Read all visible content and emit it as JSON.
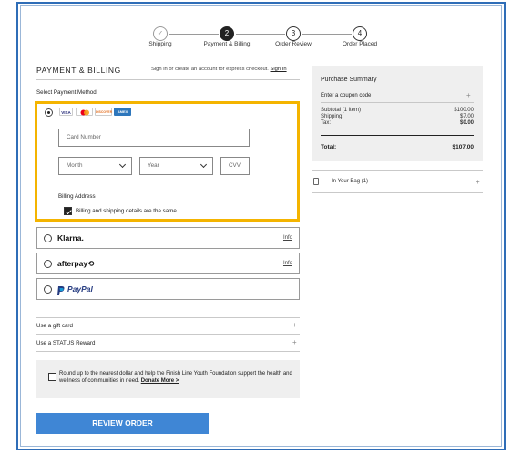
{
  "stepper": {
    "steps": [
      {
        "number": "✓",
        "label": "Shipping"
      },
      {
        "number": "2",
        "label": "Payment & Billing"
      },
      {
        "number": "3",
        "label": "Order Review"
      },
      {
        "number": "4",
        "label": "Order Placed"
      }
    ]
  },
  "header": {
    "title": "PAYMENT & BILLING",
    "signin_text": "Sign in or create an account for express checkout.",
    "signin_link": "Sign In"
  },
  "payment": {
    "section_label": "Select Payment Method",
    "card_logos": [
      "VISA",
      "MC",
      "DISCOVER",
      "AMEX"
    ],
    "card_number_placeholder": "Card Number",
    "month_placeholder": "Month",
    "year_placeholder": "Year",
    "cvv_placeholder": "CVV",
    "billing_address_label": "Billing Address",
    "billing_same_label": "Billing and shipping details are the same",
    "billing_same_checked": true,
    "options": [
      {
        "name": "Klarna.",
        "info": "Info"
      },
      {
        "name": "afterpay⟲",
        "info": "Info"
      },
      {
        "name": "PayPal",
        "info": ""
      }
    ]
  },
  "extras": {
    "gift_card_label": "Use a gift card",
    "status_reward_label": "Use a STATUS Reward",
    "plus": "+"
  },
  "roundup": {
    "text": "Round up to the nearest dollar and help the Finish Line Youth Foundation support the health and wellness of communities in need.",
    "link": "Donate More >"
  },
  "review_button": "REVIEW ORDER",
  "summary": {
    "title": "Purchase Summary",
    "coupon_label": "Enter a coupon code",
    "coupon_plus": "+",
    "subtotal_label": "Subtotal (1 item)",
    "subtotal_value": "$100.00",
    "shipping_label": "Shipping:",
    "shipping_value": "$7.00",
    "tax_label": "Tax:",
    "tax_value": "$0.00",
    "total_label": "Total:",
    "total_value": "$107.00"
  },
  "bag": {
    "label": "In Your Bag (1)",
    "plus": "+"
  },
  "colors": {
    "highlight": "#f4b400",
    "button": "#3f86d5",
    "frame": "#2f6db7",
    "paypal_dark": "#253b80",
    "paypal_light": "#179bd7"
  }
}
